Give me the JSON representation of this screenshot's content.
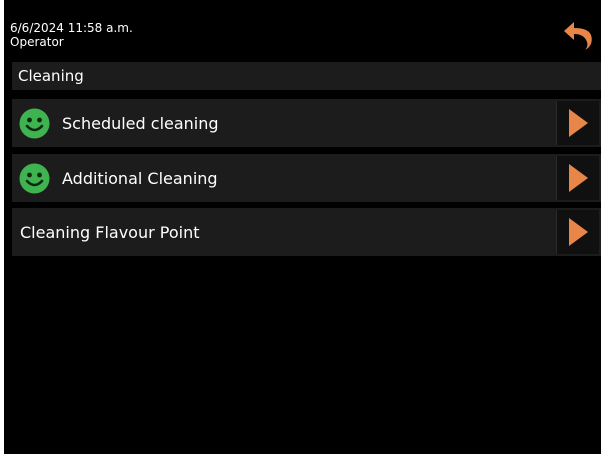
{
  "status": {
    "datetime": "6/6/2024 11:58 a.m.",
    "user": "Operator"
  },
  "header": {
    "title": "Cleaning"
  },
  "menu": {
    "items": [
      {
        "label": "Scheduled cleaning",
        "status_icon": "smiley-icon"
      },
      {
        "label": "Additional Cleaning",
        "status_icon": "smiley-icon"
      },
      {
        "label": "Cleaning Flavour Point",
        "status_icon": null
      }
    ]
  },
  "icons": {
    "back": "back-arrow-icon",
    "go": "play-arrow-icon"
  },
  "colors": {
    "background": "#000000",
    "row": "#1c1c1c",
    "accent_orange": "#e8864a",
    "status_green": "#3fb34f"
  }
}
